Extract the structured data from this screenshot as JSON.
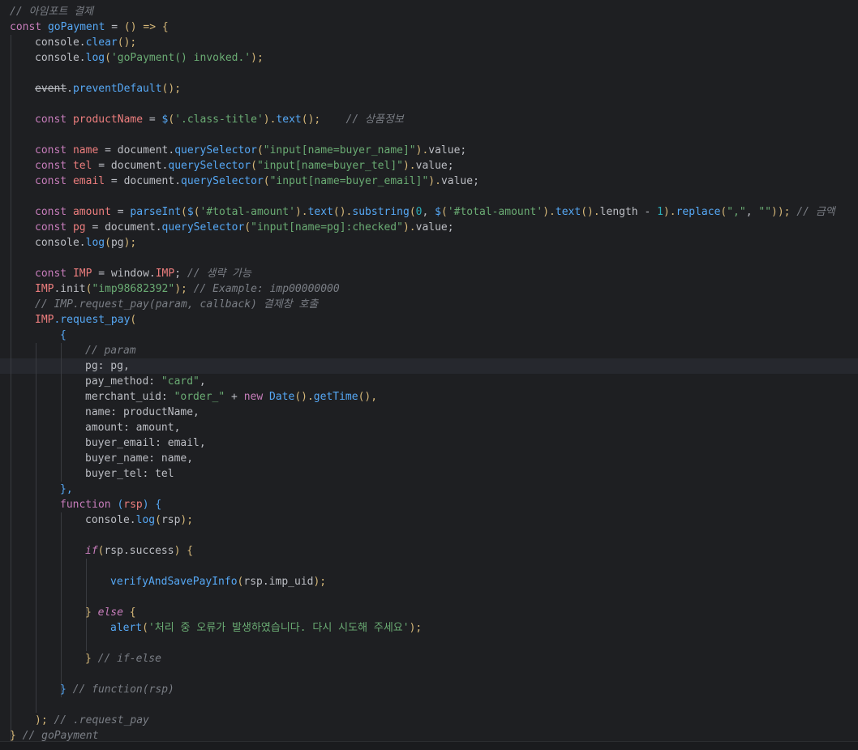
{
  "editor": {
    "colors": {
      "background": "#1e1f22",
      "keyword": "#cf8e6d",
      "function": "#56a8f5",
      "string": "#6aab73",
      "comment": "#7a7e85",
      "number": "#2aacb8",
      "variable": "#ed7e7e"
    },
    "current_line_index": 23,
    "lines": [
      {
        "indent": 0,
        "tokens": [
          {
            "t": "// 아임포트 결제",
            "c": "com"
          }
        ]
      },
      {
        "indent": 0,
        "tokens": [
          {
            "t": "const ",
            "c": "kwv"
          },
          {
            "t": "goPayment",
            "c": "fn"
          },
          {
            "t": " = ",
            "c": "plain"
          },
          {
            "t": "() => {",
            "c": "br"
          }
        ]
      },
      {
        "indent": 1,
        "tokens": [
          {
            "t": "console.",
            "c": "plain"
          },
          {
            "t": "clear",
            "c": "fn"
          },
          {
            "t": "();",
            "c": "br"
          }
        ]
      },
      {
        "indent": 1,
        "tokens": [
          {
            "t": "console.",
            "c": "plain"
          },
          {
            "t": "log",
            "c": "fn"
          },
          {
            "t": "(",
            "c": "br"
          },
          {
            "t": "'goPayment() invoked.'",
            "c": "str"
          },
          {
            "t": ");",
            "c": "br"
          }
        ]
      },
      {
        "indent": 0,
        "tokens": []
      },
      {
        "indent": 1,
        "tokens": [
          {
            "t": "event",
            "c": "plain strike"
          },
          {
            "t": ".",
            "c": "plain"
          },
          {
            "t": "preventDefault",
            "c": "fn"
          },
          {
            "t": "();",
            "c": "br"
          }
        ]
      },
      {
        "indent": 0,
        "tokens": []
      },
      {
        "indent": 1,
        "tokens": [
          {
            "t": "const ",
            "c": "kwv"
          },
          {
            "t": "productName",
            "c": "var"
          },
          {
            "t": " = ",
            "c": "plain"
          },
          {
            "t": "$",
            "c": "fn"
          },
          {
            "t": "(",
            "c": "br"
          },
          {
            "t": "'.class-title'",
            "c": "str"
          },
          {
            "t": ").",
            "c": "br"
          },
          {
            "t": "text",
            "c": "fn"
          },
          {
            "t": "();",
            "c": "br"
          },
          {
            "t": "    // 상품정보",
            "c": "com"
          }
        ]
      },
      {
        "indent": 0,
        "tokens": []
      },
      {
        "indent": 1,
        "tokens": [
          {
            "t": "const ",
            "c": "kwv"
          },
          {
            "t": "name",
            "c": "var"
          },
          {
            "t": " = document.",
            "c": "plain"
          },
          {
            "t": "querySelector",
            "c": "fn"
          },
          {
            "t": "(",
            "c": "br"
          },
          {
            "t": "\"input[name=buyer_name]\"",
            "c": "str"
          },
          {
            "t": ").",
            "c": "br"
          },
          {
            "t": "value;",
            "c": "plain"
          }
        ]
      },
      {
        "indent": 1,
        "tokens": [
          {
            "t": "const ",
            "c": "kwv"
          },
          {
            "t": "tel",
            "c": "var"
          },
          {
            "t": " = document.",
            "c": "plain"
          },
          {
            "t": "querySelector",
            "c": "fn"
          },
          {
            "t": "(",
            "c": "br"
          },
          {
            "t": "\"input[name=buyer_tel]\"",
            "c": "str"
          },
          {
            "t": ").",
            "c": "br"
          },
          {
            "t": "value;",
            "c": "plain"
          }
        ]
      },
      {
        "indent": 1,
        "tokens": [
          {
            "t": "const ",
            "c": "kwv"
          },
          {
            "t": "email",
            "c": "var"
          },
          {
            "t": " = document.",
            "c": "plain"
          },
          {
            "t": "querySelector",
            "c": "fn"
          },
          {
            "t": "(",
            "c": "br"
          },
          {
            "t": "\"input[name=buyer_email]\"",
            "c": "str"
          },
          {
            "t": ").",
            "c": "br"
          },
          {
            "t": "value;",
            "c": "plain"
          }
        ]
      },
      {
        "indent": 0,
        "tokens": []
      },
      {
        "indent": 1,
        "tokens": [
          {
            "t": "const ",
            "c": "kwv"
          },
          {
            "t": "amount",
            "c": "var"
          },
          {
            "t": " = ",
            "c": "plain"
          },
          {
            "t": "parseInt",
            "c": "fn"
          },
          {
            "t": "(",
            "c": "br"
          },
          {
            "t": "$",
            "c": "fn"
          },
          {
            "t": "(",
            "c": "br"
          },
          {
            "t": "'#total-amount'",
            "c": "str"
          },
          {
            "t": ").",
            "c": "br"
          },
          {
            "t": "text",
            "c": "fn"
          },
          {
            "t": "().",
            "c": "br"
          },
          {
            "t": "substring",
            "c": "fn"
          },
          {
            "t": "(",
            "c": "br"
          },
          {
            "t": "0",
            "c": "num"
          },
          {
            "t": ", ",
            "c": "plain"
          },
          {
            "t": "$",
            "c": "fn"
          },
          {
            "t": "(",
            "c": "br"
          },
          {
            "t": "'#total-amount'",
            "c": "str"
          },
          {
            "t": ").",
            "c": "br"
          },
          {
            "t": "text",
            "c": "fn"
          },
          {
            "t": "().",
            "c": "br"
          },
          {
            "t": "length - ",
            "c": "plain"
          },
          {
            "t": "1",
            "c": "num"
          },
          {
            "t": ").",
            "c": "br"
          },
          {
            "t": "replace",
            "c": "fn"
          },
          {
            "t": "(",
            "c": "br"
          },
          {
            "t": "\",\"",
            "c": "str"
          },
          {
            "t": ", ",
            "c": "plain"
          },
          {
            "t": "\"\"",
            "c": "str"
          },
          {
            "t": "));",
            "c": "br"
          },
          {
            "t": " // 금액",
            "c": "com"
          }
        ]
      },
      {
        "indent": 1,
        "tokens": [
          {
            "t": "const ",
            "c": "kwv"
          },
          {
            "t": "pg",
            "c": "var"
          },
          {
            "t": " = document.",
            "c": "plain"
          },
          {
            "t": "querySelector",
            "c": "fn"
          },
          {
            "t": "(",
            "c": "br"
          },
          {
            "t": "\"input[name=pg]:checked\"",
            "c": "str"
          },
          {
            "t": ").",
            "c": "br"
          },
          {
            "t": "value;",
            "c": "plain"
          }
        ]
      },
      {
        "indent": 1,
        "tokens": [
          {
            "t": "console.",
            "c": "plain"
          },
          {
            "t": "log",
            "c": "fn"
          },
          {
            "t": "(",
            "c": "br"
          },
          {
            "t": "pg",
            "c": "plain"
          },
          {
            "t": ");",
            "c": "br"
          }
        ]
      },
      {
        "indent": 0,
        "tokens": []
      },
      {
        "indent": 1,
        "tokens": [
          {
            "t": "const ",
            "c": "kwv"
          },
          {
            "t": "IMP",
            "c": "var"
          },
          {
            "t": " = window.",
            "c": "plain"
          },
          {
            "t": "IMP",
            "c": "var"
          },
          {
            "t": "; ",
            "c": "plain"
          },
          {
            "t": "// 생략 가능",
            "c": "com"
          }
        ]
      },
      {
        "indent": 1,
        "tokens": [
          {
            "t": "IMP",
            "c": "var"
          },
          {
            "t": ".init",
            "c": "plain"
          },
          {
            "t": "(",
            "c": "br"
          },
          {
            "t": "\"imp98682392\"",
            "c": "str"
          },
          {
            "t": "); ",
            "c": "br"
          },
          {
            "t": "// Example: imp00000000",
            "c": "com"
          }
        ]
      },
      {
        "indent": 1,
        "tokens": [
          {
            "t": "// IMP.request_pay(param, callback) 결제창 호출",
            "c": "com"
          }
        ]
      },
      {
        "indent": 1,
        "tokens": [
          {
            "t": "IMP",
            "c": "var"
          },
          {
            "t": ".request_pay",
            "c": "fn"
          },
          {
            "t": "(",
            "c": "br"
          }
        ]
      },
      {
        "indent": 2,
        "tokens": [
          {
            "t": "{",
            "c": "fn"
          }
        ]
      },
      {
        "indent": 3,
        "tokens": [
          {
            "t": "// param",
            "c": "com"
          }
        ]
      },
      {
        "indent": 3,
        "tokens": [
          {
            "t": "pg: pg,",
            "c": "plain"
          }
        ]
      },
      {
        "indent": 3,
        "tokens": [
          {
            "t": "pay_method: ",
            "c": "plain"
          },
          {
            "t": "\"card\"",
            "c": "str"
          },
          {
            "t": ",",
            "c": "plain"
          }
        ]
      },
      {
        "indent": 3,
        "tokens": [
          {
            "t": "merchant_uid: ",
            "c": "plain"
          },
          {
            "t": "\"order_\"",
            "c": "str"
          },
          {
            "t": " + ",
            "c": "plain"
          },
          {
            "t": "new ",
            "c": "kwv"
          },
          {
            "t": "Date",
            "c": "fn"
          },
          {
            "t": "().",
            "c": "br"
          },
          {
            "t": "getTime",
            "c": "fn"
          },
          {
            "t": "(),",
            "c": "br"
          }
        ]
      },
      {
        "indent": 3,
        "tokens": [
          {
            "t": "name: productName,",
            "c": "plain"
          }
        ]
      },
      {
        "indent": 3,
        "tokens": [
          {
            "t": "amount: amount,",
            "c": "plain"
          }
        ]
      },
      {
        "indent": 3,
        "tokens": [
          {
            "t": "buyer_email: email,",
            "c": "plain"
          }
        ]
      },
      {
        "indent": 3,
        "tokens": [
          {
            "t": "buyer_name: name,",
            "c": "plain"
          }
        ]
      },
      {
        "indent": 3,
        "tokens": [
          {
            "t": "buyer_tel: tel",
            "c": "plain"
          }
        ]
      },
      {
        "indent": 2,
        "tokens": [
          {
            "t": "},",
            "c": "fn"
          }
        ]
      },
      {
        "indent": 2,
        "tokens": [
          {
            "t": "function ",
            "c": "kwv"
          },
          {
            "t": "(",
            "c": "fn"
          },
          {
            "t": "rsp",
            "c": "var"
          },
          {
            "t": ") {",
            "c": "fn"
          }
        ]
      },
      {
        "indent": 3,
        "tokens": [
          {
            "t": "console.",
            "c": "plain"
          },
          {
            "t": "log",
            "c": "fn"
          },
          {
            "t": "(",
            "c": "br"
          },
          {
            "t": "rsp",
            "c": "plain"
          },
          {
            "t": ");",
            "c": "br"
          }
        ]
      },
      {
        "indent": 0,
        "tokens": []
      },
      {
        "indent": 3,
        "tokens": [
          {
            "t": "if",
            "c": "kwv ital"
          },
          {
            "t": "(",
            "c": "br"
          },
          {
            "t": "rsp.success",
            "c": "plain"
          },
          {
            "t": ") {",
            "c": "br"
          }
        ]
      },
      {
        "indent": 0,
        "tokens": []
      },
      {
        "indent": 4,
        "tokens": [
          {
            "t": "verifyAndSavePayInfo",
            "c": "fn"
          },
          {
            "t": "(",
            "c": "br"
          },
          {
            "t": "rsp.imp_uid",
            "c": "plain"
          },
          {
            "t": ");",
            "c": "br"
          }
        ]
      },
      {
        "indent": 0,
        "tokens": []
      },
      {
        "indent": 3,
        "tokens": [
          {
            "t": "} ",
            "c": "br"
          },
          {
            "t": "else ",
            "c": "kwv ital"
          },
          {
            "t": "{",
            "c": "br"
          }
        ]
      },
      {
        "indent": 4,
        "tokens": [
          {
            "t": "alert",
            "c": "fn"
          },
          {
            "t": "(",
            "c": "br"
          },
          {
            "t": "'처리 중 오류가 발생하였습니다. 다시 시도해 주세요'",
            "c": "str"
          },
          {
            "t": ");",
            "c": "br"
          }
        ]
      },
      {
        "indent": 0,
        "tokens": []
      },
      {
        "indent": 3,
        "tokens": [
          {
            "t": "} ",
            "c": "br"
          },
          {
            "t": "// if-else",
            "c": "com"
          }
        ]
      },
      {
        "indent": 0,
        "tokens": []
      },
      {
        "indent": 2,
        "tokens": [
          {
            "t": "} ",
            "c": "fn"
          },
          {
            "t": "// function(rsp)",
            "c": "com"
          }
        ]
      },
      {
        "indent": 0,
        "tokens": []
      },
      {
        "indent": 1,
        "tokens": [
          {
            "t": "); ",
            "c": "br"
          },
          {
            "t": "// .request_pay",
            "c": "com"
          }
        ]
      },
      {
        "indent": 0,
        "tokens": [
          {
            "t": "} ",
            "c": "br"
          },
          {
            "t": "// goPayment",
            "c": "com"
          }
        ]
      }
    ],
    "guides": [
      {
        "level": 1,
        "from": 2,
        "to": 47
      },
      {
        "level": 2,
        "from": 22,
        "to": 45
      },
      {
        "level": 3,
        "from": 22,
        "to": 30
      },
      {
        "level": 3,
        "from": 33,
        "to": 44
      },
      {
        "level": 4,
        "from": 36,
        "to": 41
      }
    ]
  }
}
